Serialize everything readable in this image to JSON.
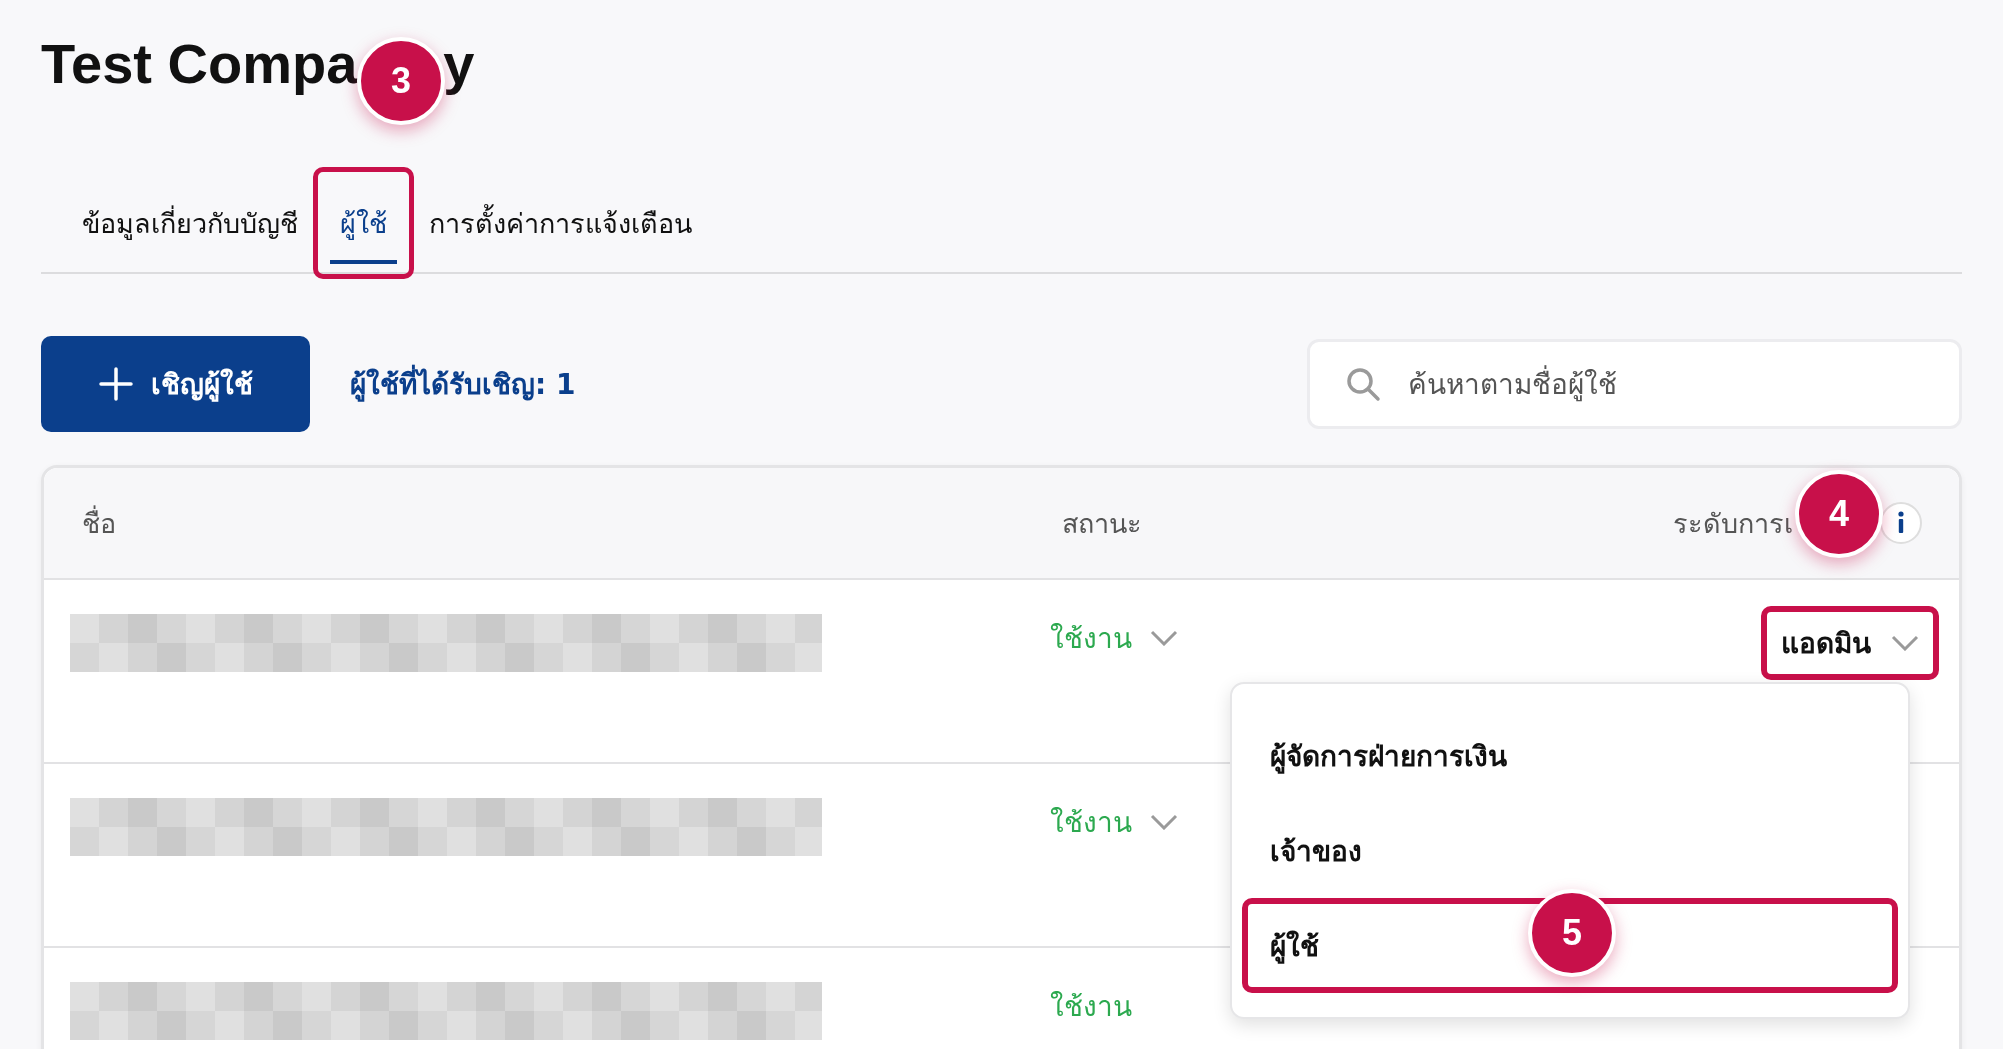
{
  "title_parts": [
    "Test Compa",
    "y"
  ],
  "tabs": [
    {
      "label": "ข้อมูลเกี่ยวกับบัญชี",
      "selected": false,
      "highlighted": false
    },
    {
      "label": "ผู้ใช้",
      "selected": true,
      "highlighted": true
    },
    {
      "label": "การตั้งค่าการแจ้งเตือน",
      "selected": false,
      "highlighted": false
    }
  ],
  "invite_button": {
    "label": "เชิญผู้ใช้"
  },
  "invited_count": "ผู้ใช้ที่ได้รับเชิญ: 1",
  "search": {
    "placeholder": "ค้นหาตามชื่อผู้ใช้"
  },
  "table": {
    "columns": [
      "ชื่อ",
      "สถานะ",
      "ระดับการเ"
    ],
    "rows": [
      {
        "status": "ใช้งาน",
        "status_editable": true,
        "role": "แอดมิน",
        "role_editable": true,
        "highlighted": true
      },
      {
        "status": "ใช้งาน",
        "status_editable": true
      },
      {
        "status": "ใช้งาน",
        "status_editable": false
      }
    ]
  },
  "role_menu": {
    "items": [
      {
        "label": "ผู้จัดการฝ่ายการเงิน",
        "highlighted": false
      },
      {
        "label": "เจ้าของ",
        "highlighted": false
      },
      {
        "label": "ผู้ใช้",
        "highlighted": true
      }
    ]
  },
  "callouts": [
    {
      "number": "3"
    },
    {
      "number": "4"
    },
    {
      "number": "5"
    }
  ]
}
